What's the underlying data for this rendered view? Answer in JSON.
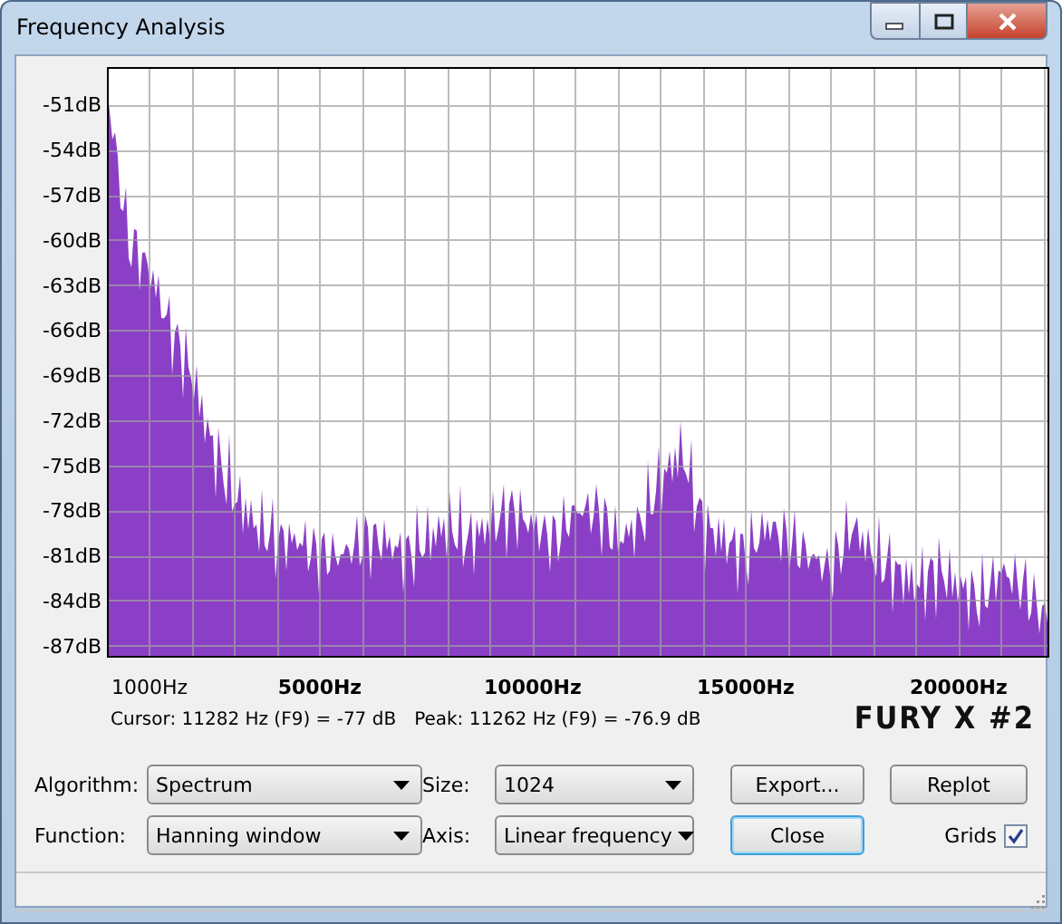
{
  "window": {
    "title": "Frequency Analysis"
  },
  "spectrum": {
    "y_labels": [
      "-51dB",
      "-54dB",
      "-57dB",
      "-60dB",
      "-63dB",
      "-66dB",
      "-69dB",
      "-72dB",
      "-75dB",
      "-78dB",
      "-81dB",
      "-84dB",
      "-87dB"
    ],
    "x_labels": [
      "1000Hz",
      "5000Hz",
      "10000Hz",
      "15000Hz",
      "20000Hz"
    ]
  },
  "readout": {
    "cursor": "Cursor: 11282 Hz (F9) = -77 dB",
    "peak": "Peak: 11262 Hz (F9) = -76.9 dB"
  },
  "caption": "FURY X #2",
  "settings": [
    {
      "label": "Algorithm:",
      "value": "Spectrum"
    },
    {
      "label": "Size:",
      "value": "1024"
    },
    {
      "label": "Function:",
      "value": "Hanning window"
    },
    {
      "label": "Axis:",
      "value": "Linear frequency"
    }
  ],
  "buttons": [
    {
      "label": "Export...",
      "focused": false
    },
    {
      "label": "Replot",
      "focused": false
    },
    {
      "label": "Close",
      "focused": true
    }
  ],
  "grids": {
    "label": "Grids",
    "checked": true
  }
}
